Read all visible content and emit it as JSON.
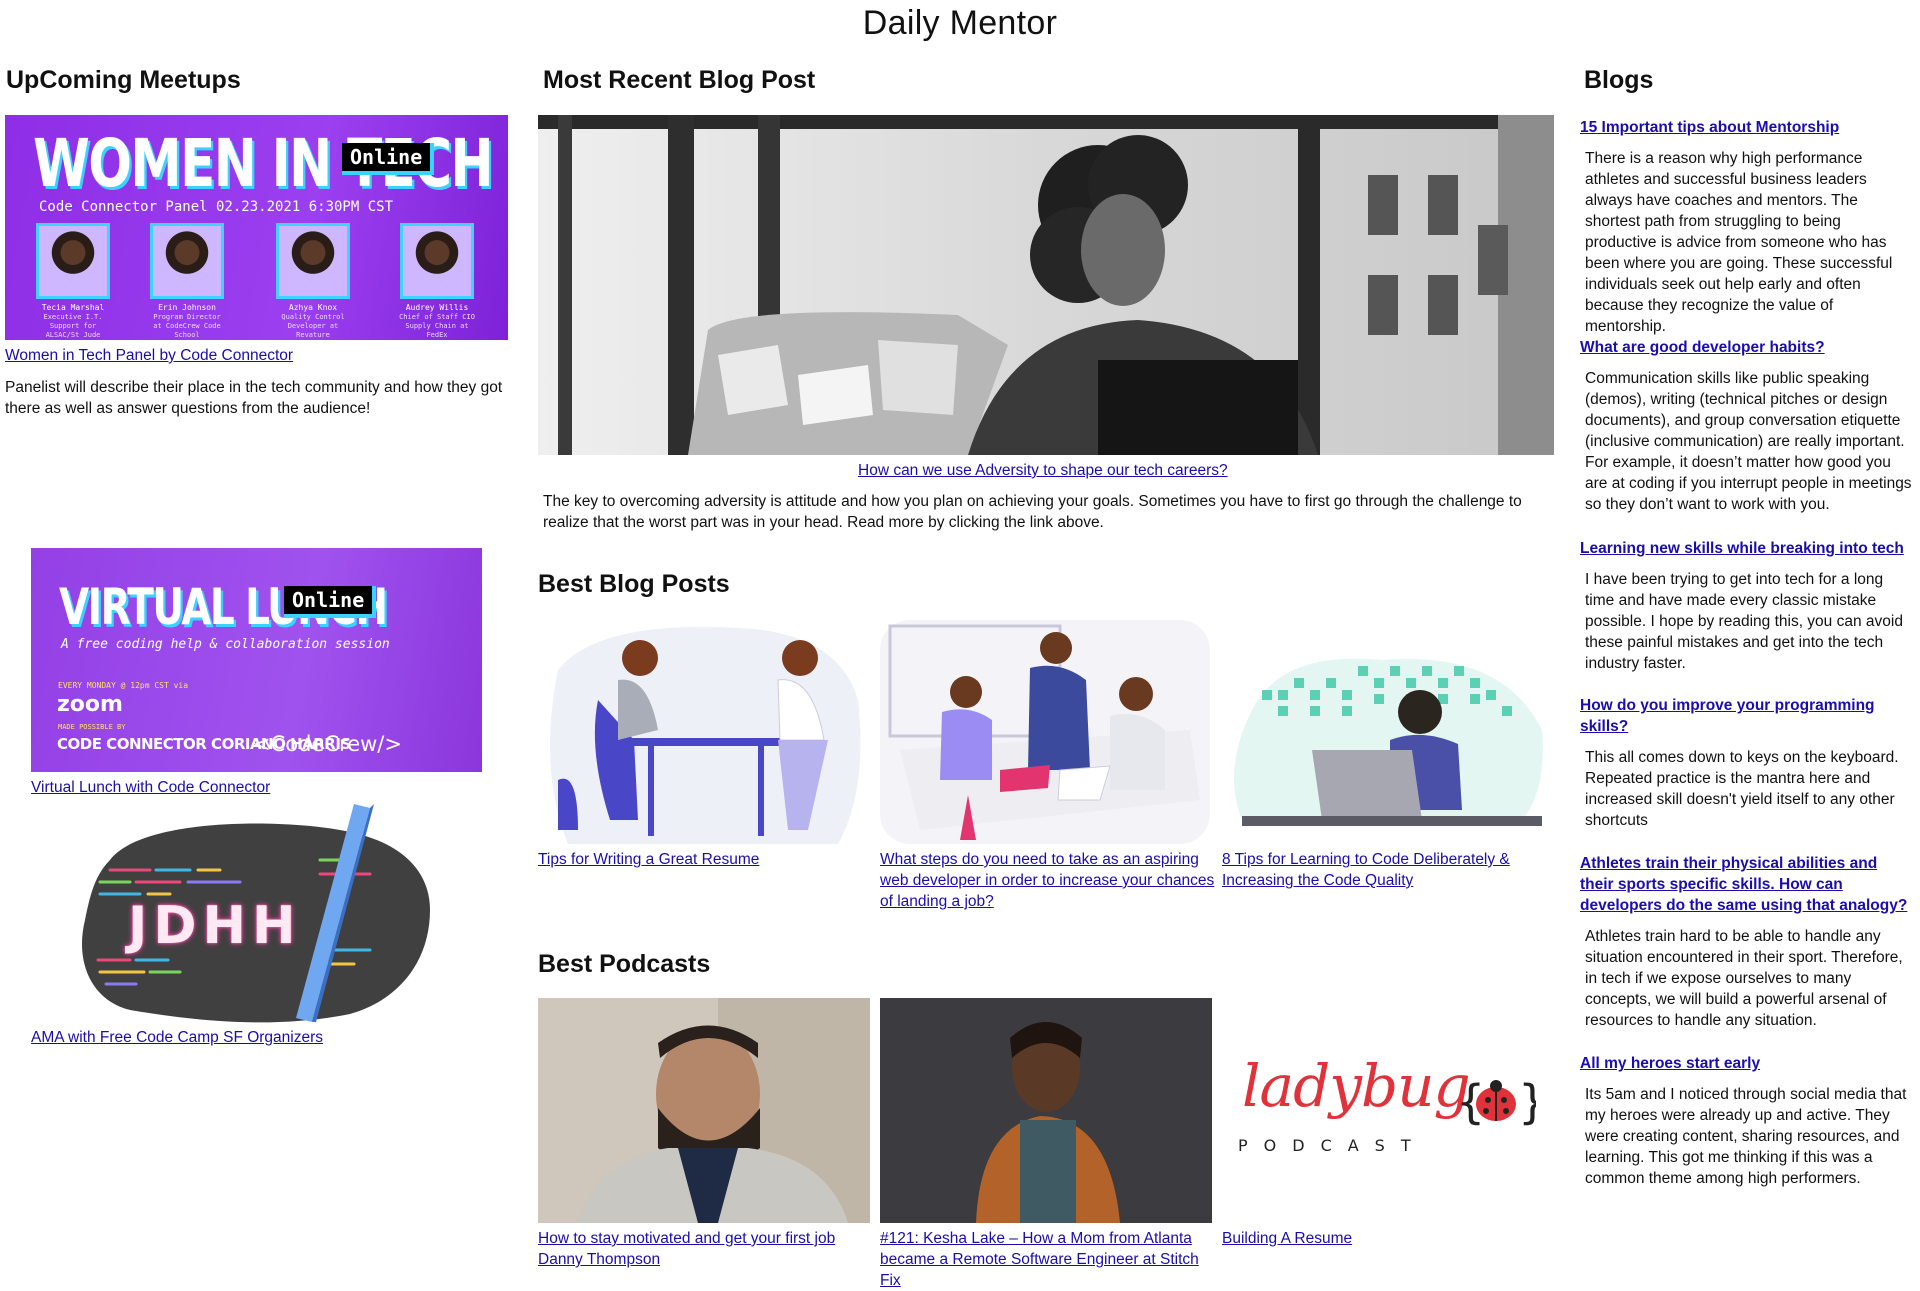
{
  "site": {
    "title": "Daily Mentor"
  },
  "upcoming": {
    "heading": "UpComing Meetups",
    "women_in_tech": {
      "banner_title": "WOMEN IN TECH",
      "online_tag": "Online",
      "panel_line": "Code Connector Panel 02.23.2021 6:30PM CST",
      "speakers": [
        {
          "name": "Tecia Marshal",
          "role": "Executive I.T. Support for ALSAC/St Jude"
        },
        {
          "name": "Erin Johnson",
          "role": "Program Director at CodeCrew Code School"
        },
        {
          "name": "Azhya Knox",
          "role": "Quality Control Developer at Revature"
        },
        {
          "name": "Audrey Willis",
          "role": "Chief of Staff CIO Supply Chain at FedEx"
        }
      ],
      "link": "Women in Tech Panel by Code Connector",
      "description": "Panelist will describe their place in the tech community and how they got there as well as answer questions from the audience!"
    },
    "virtual_lunch": {
      "banner_title": "VIRTUAL LUNCH",
      "online_tag": "Online",
      "subtitle": "A free coding help & collaboration session",
      "schedule": "EVERY MONDAY @ 12pm CST via",
      "platform": "zoom",
      "made_possible": "MADE POSSIBLE BY",
      "sponsors": "CODE CONNECTOR  CORIANO HARRIS",
      "codecrew": "<CodeCrew/>",
      "link": "Virtual Lunch with Code Connector"
    },
    "ama": {
      "logo_text": "JDHH",
      "link": "AMA with Free Code Camp SF Organizers"
    }
  },
  "recent": {
    "heading": "Most Recent Blog Post",
    "link": "How can we use Adversity to shape our tech careers?",
    "description": "The key to overcoming adversity is attitude and how you plan on achieving your goals. Sometimes you have to first go through the challenge to realize that the worst part was in your head. Read more by clicking the link above."
  },
  "best_blogs": {
    "heading": "Best Blog Posts",
    "items": [
      {
        "link": "Tips for Writing a Great Resume"
      },
      {
        "link": "What steps do you need to take as an aspiring web developer in order to increase your chances of landing a job?"
      },
      {
        "link": "8 Tips for Learning to Code Deliberately & Increasing the Code Quality"
      }
    ]
  },
  "best_podcasts": {
    "heading": "Best Podcasts",
    "items": [
      {
        "link": "How to stay motivated and get your first job Danny Thompson"
      },
      {
        "link": "#121: Kesha Lake – How a Mom from Atlanta became a Remote Software Engineer at Stitch Fix"
      },
      {
        "link": "Building A Resume",
        "logo_script": "ladybug",
        "logo_word": "PODCAST"
      }
    ]
  },
  "blogs": {
    "heading": "Blogs",
    "items": [
      {
        "title": "15 Important tips about Mentorship",
        "text": "There is a reason why high performance athletes and successful business leaders always have coaches and mentors. The shortest path from struggling to being productive is advice from someone who has been where you are going. These successful individuals seek out help early and often because they recognize the value of mentorship."
      },
      {
        "title": "What are good developer habits?",
        "text": "Communication skills like public speaking (demos), writing (technical pitches or design documents), and group conversation etiquette (inclusive communication) are really important. For example, it doesn’t matter how good you are at coding if you interrupt people in meetings so they don’t want to work with you."
      },
      {
        "title": "Learning new skills while breaking into tech",
        "text": "I have been trying to get into tech for a long time and have made every classic mistake possible. I hope by reading this, you can avoid these painful mistakes and get into the tech industry faster."
      },
      {
        "title": "How do you improve your programming skills?",
        "text": "This all comes down to keys on the keyboard. Repeated practice is the mantra here and increased skill doesn't yield itself to any other shortcuts"
      },
      {
        "title": "Athletes train their physical abilities and their sports specific skills. How can developers do the same using that analogy?",
        "text": "Athletes train hard to be able to handle any situation encountered in their sport. Therefore, in tech if we expose ourselves to many concepts, we will build a powerful arsenal of resources to handle any situation."
      },
      {
        "title": "All my heroes start early",
        "text": "Its 5am and I noticed through social media that my heroes were already up and active. They were creating content, sharing resources, and learning. This got me thinking if this was a common theme among high performers."
      }
    ]
  }
}
